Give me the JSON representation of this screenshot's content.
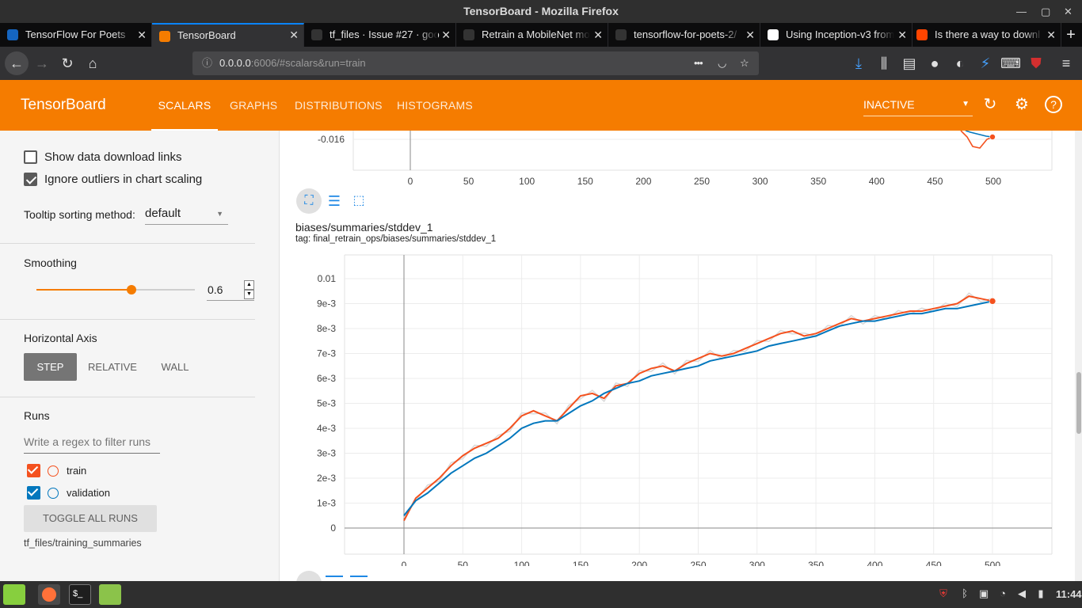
{
  "window": {
    "title": "TensorBoard - Mozilla Firefox"
  },
  "tabs": [
    {
      "label": "TensorFlow For Poets",
      "favicon_color": "#1565c0"
    },
    {
      "label": "TensorBoard",
      "favicon_color": "#f57c00"
    },
    {
      "label": "tf_files · Issue #27 · goo",
      "favicon_color": "#333333"
    },
    {
      "label": "Retrain a MobileNet mo",
      "favicon_color": "#333333"
    },
    {
      "label": "tensorflow-for-poets-2/",
      "favicon_color": "#333333"
    },
    {
      "label": "Using Inception-v3 from",
      "favicon_color": "#ffffff"
    },
    {
      "label": "Is there a way to downl",
      "favicon_color": "#ff4500"
    }
  ],
  "tab_close_glyph": "✕",
  "new_tab_glyph": "+",
  "nav": {
    "url_host": "0.0.0.0",
    "url_path": ":6006/#scalars&run=train",
    "more_glyph": "•••"
  },
  "tensorboard": {
    "brand": "TensorBoard",
    "tabs": [
      "SCALARS",
      "GRAPHS",
      "DISTRIBUTIONS",
      "HISTOGRAMS"
    ],
    "run_status": "INACTIVE",
    "accent": "#f57c00"
  },
  "sidebar": {
    "show_download_links": "Show data download links",
    "ignore_outliers": "Ignore outliers in chart scaling",
    "tooltip_label": "Tooltip sorting method:",
    "tooltip_value": "default",
    "smoothing_title": "Smoothing",
    "smoothing_value": "0.6",
    "smoothing_fraction": 0.6,
    "haxis_title": "Horizontal Axis",
    "haxis_options": [
      "STEP",
      "RELATIVE",
      "WALL"
    ],
    "runs_title": "Runs",
    "runs_filter_placeholder": "Write a regex to filter runs",
    "runs": [
      {
        "name": "train",
        "color": "#f4511e"
      },
      {
        "name": "validation",
        "color": "#0277bd"
      }
    ],
    "toggle_all": "TOGGLE ALL RUNS",
    "log_dir": "tf_files/training_summaries"
  },
  "chart_data": [
    {
      "type": "line",
      "title": "",
      "y_ticks": [
        "-0.016"
      ],
      "x_ticks": [
        0,
        50,
        100,
        150,
        200,
        250,
        300,
        350,
        400,
        450,
        500
      ],
      "partial": true
    },
    {
      "type": "line",
      "title": "biases/summaries/stddev_1",
      "tag": "tag: final_retrain_ops/biases/summaries/stddev_1",
      "xlim": [
        0,
        500
      ],
      "ylim": [
        0,
        0.01
      ],
      "x_ticks": [
        0,
        50,
        100,
        150,
        200,
        250,
        300,
        350,
        400,
        450,
        500
      ],
      "y_ticks": [
        "0",
        "1e-3",
        "2e-3",
        "3e-3",
        "4e-3",
        "5e-3",
        "6e-3",
        "7e-3",
        "8e-3",
        "9e-3",
        "0.01"
      ],
      "grid": true,
      "series": [
        {
          "name": "train",
          "color": "#f4511e",
          "x": [
            0,
            10,
            20,
            30,
            40,
            50,
            60,
            70,
            80,
            90,
            100,
            110,
            120,
            130,
            140,
            150,
            160,
            170,
            180,
            190,
            200,
            210,
            220,
            230,
            240,
            250,
            260,
            270,
            280,
            290,
            300,
            310,
            320,
            330,
            340,
            350,
            360,
            370,
            380,
            390,
            400,
            410,
            420,
            430,
            440,
            450,
            460,
            470,
            480,
            490,
            500
          ],
          "y": [
            0.0003,
            0.0012,
            0.0016,
            0.002,
            0.0025,
            0.0029,
            0.0032,
            0.0034,
            0.0036,
            0.004,
            0.0045,
            0.0047,
            0.0045,
            0.0043,
            0.0048,
            0.0053,
            0.0054,
            0.0052,
            0.0057,
            0.0058,
            0.0062,
            0.0064,
            0.0065,
            0.0063,
            0.0066,
            0.0068,
            0.007,
            0.0069,
            0.007,
            0.0072,
            0.0074,
            0.0076,
            0.0078,
            0.0079,
            0.0077,
            0.0078,
            0.008,
            0.0082,
            0.0084,
            0.0083,
            0.0084,
            0.0085,
            0.0086,
            0.0087,
            0.0087,
            0.0088,
            0.0089,
            0.009,
            0.0093,
            0.0092,
            0.0091
          ]
        },
        {
          "name": "validation",
          "color": "#0277bd",
          "x": [
            0,
            10,
            20,
            30,
            40,
            50,
            60,
            70,
            80,
            90,
            100,
            110,
            120,
            130,
            140,
            150,
            160,
            170,
            180,
            190,
            200,
            210,
            220,
            230,
            240,
            250,
            260,
            270,
            280,
            290,
            300,
            310,
            320,
            330,
            340,
            350,
            360,
            370,
            380,
            390,
            400,
            410,
            420,
            430,
            440,
            450,
            460,
            470,
            480,
            490,
            500
          ],
          "y": [
            0.0005,
            0.0011,
            0.0014,
            0.0018,
            0.0022,
            0.0025,
            0.0028,
            0.003,
            0.0033,
            0.0036,
            0.004,
            0.0042,
            0.0043,
            0.0043,
            0.0046,
            0.0049,
            0.0051,
            0.0054,
            0.0056,
            0.0058,
            0.0059,
            0.0061,
            0.0062,
            0.0063,
            0.0064,
            0.0065,
            0.0067,
            0.0068,
            0.0069,
            0.007,
            0.0071,
            0.0073,
            0.0074,
            0.0075,
            0.0076,
            0.0077,
            0.0079,
            0.0081,
            0.0082,
            0.0083,
            0.0083,
            0.0084,
            0.0085,
            0.0086,
            0.0086,
            0.0087,
            0.0088,
            0.0088,
            0.0089,
            0.009,
            0.0091
          ]
        }
      ]
    }
  ],
  "taskbar": {
    "clock": "11:44"
  }
}
